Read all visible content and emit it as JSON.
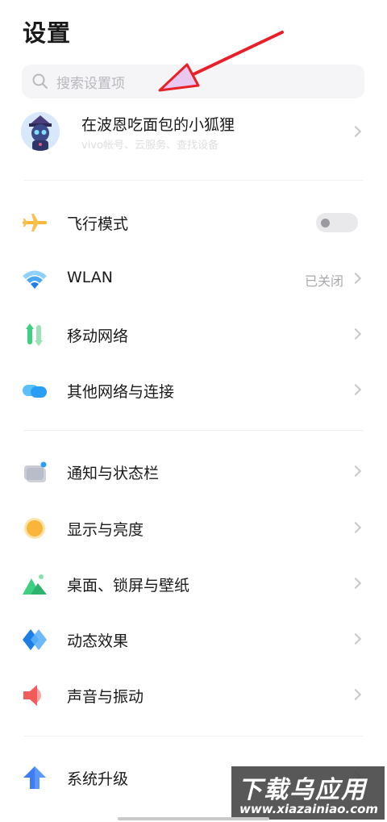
{
  "page": {
    "title": "设置"
  },
  "search": {
    "placeholder": "搜索设置项"
  },
  "account": {
    "name": "在波恩吃面包的小狐狸",
    "subtitle": "vivo帐号、云服务、查找设备"
  },
  "group1": [
    {
      "label": "飞行模式",
      "icon": "airplane-icon",
      "control": "toggle",
      "toggle_on": false
    },
    {
      "label": "WLAN",
      "icon": "wifi-icon",
      "value": "已关闭"
    },
    {
      "label": "移动网络",
      "icon": "mobile-network-icon"
    },
    {
      "label": "其他网络与连接",
      "icon": "other-network-icon"
    }
  ],
  "group2": [
    {
      "label": "通知与状态栏",
      "icon": "notification-icon"
    },
    {
      "label": "显示与亮度",
      "icon": "brightness-icon"
    },
    {
      "label": "桌面、锁屏与壁纸",
      "icon": "wallpaper-icon"
    },
    {
      "label": "动态效果",
      "icon": "dynamic-effects-icon"
    },
    {
      "label": "声音与振动",
      "icon": "sound-icon"
    }
  ],
  "group3": [
    {
      "label": "系统升级",
      "icon": "system-upgrade-icon"
    }
  ],
  "watermark": {
    "title": "下载乌应用",
    "url": "www.xiazainiao.com"
  },
  "colors": {
    "accent_red": "#e8202a",
    "arrow_fill": "#e9c8ef"
  }
}
